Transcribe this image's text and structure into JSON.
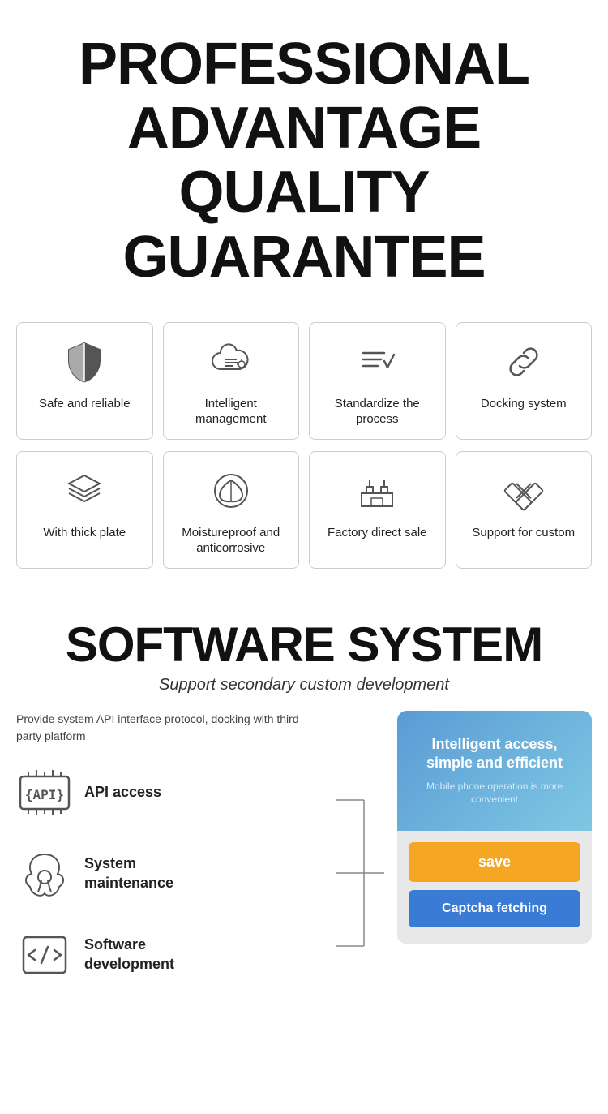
{
  "header": {
    "line1": "PROFESSIONAL",
    "line2": "ADVANTAGE",
    "line3": "QUALITY GUARANTEE"
  },
  "features": {
    "row1": [
      {
        "label": "Safe and reliable",
        "icon": "shield"
      },
      {
        "label": "Intelligent management",
        "icon": "cloud-settings"
      },
      {
        "label": "Standardize the process",
        "icon": "checklist"
      },
      {
        "label": "Docking system",
        "icon": "link"
      }
    ],
    "row2": [
      {
        "label": "With thick plate",
        "icon": "layers"
      },
      {
        "label": "Moistureproof and anticorrosive",
        "icon": "leaf-shield"
      },
      {
        "label": "Factory direct sale",
        "icon": "factory"
      },
      {
        "label": "Support for custom",
        "icon": "tools"
      }
    ]
  },
  "software": {
    "title": "SOFTWARE SYSTEM",
    "subtitle": "Support secondary custom development",
    "description": "Provide system API interface protocol, docking with third party platform",
    "items": [
      {
        "label": "API access",
        "icon": "api"
      },
      {
        "label": "System\nmaintenance",
        "icon": "maintenance"
      },
      {
        "label": "Software\ndevelopment",
        "icon": "code"
      }
    ],
    "phone": {
      "header_title": "Intelligent access, simple and efficient",
      "header_sub": "Mobile phone operation is more convenient",
      "btn_save": "save",
      "btn_captcha": "Captcha fetching"
    }
  }
}
